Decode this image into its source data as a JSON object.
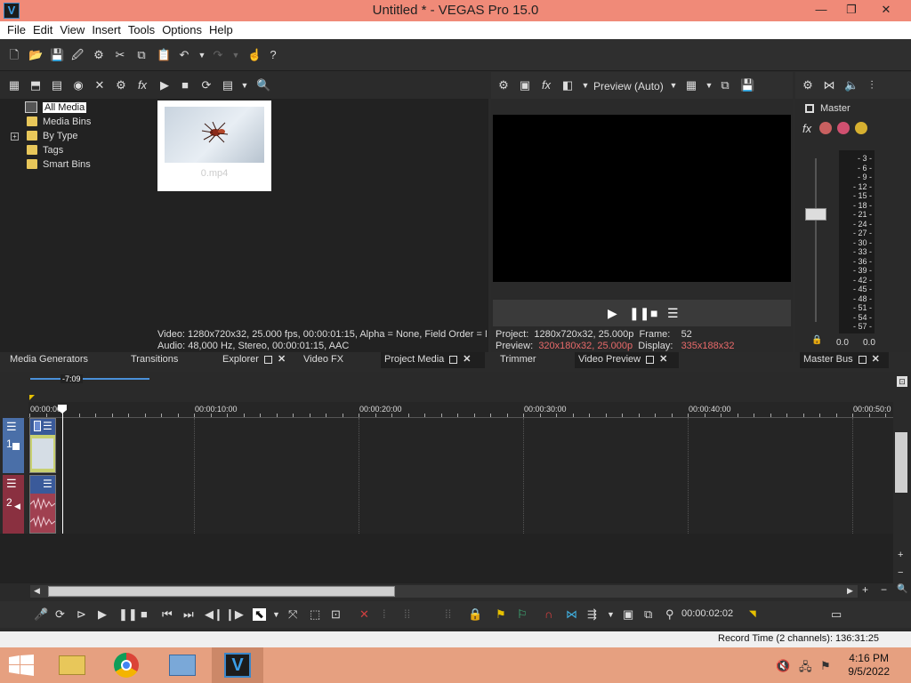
{
  "window": {
    "title": "Untitled * - VEGAS Pro 15.0",
    "logo_letter": "V",
    "min": "—",
    "max": "❐",
    "close": "✕"
  },
  "menu": [
    "File",
    "Edit",
    "View",
    "Insert",
    "Tools",
    "Options",
    "Help"
  ],
  "media_tree": [
    {
      "label": "All Media",
      "selected": true
    },
    {
      "label": "Media Bins"
    },
    {
      "label": "By Type",
      "expandable": true
    },
    {
      "label": "Tags"
    },
    {
      "label": "Smart Bins"
    }
  ],
  "media_file": {
    "name": "0.mp4"
  },
  "media_info": {
    "video": "Video: 1280x720x32, 25.000 fps, 00:00:01:15, Alpha = None, Field Order = None",
    "audio": "Audio: 48,000 Hz, Stereo, 00:00:01:15, AAC"
  },
  "left_tabs": [
    {
      "label": "Media Generators"
    },
    {
      "label": "Transitions"
    },
    {
      "label": "Explorer"
    },
    {
      "label": "Video FX"
    },
    {
      "label": "Project Media",
      "active": true
    }
  ],
  "preview": {
    "mode": "Preview (Auto)",
    "project_label": "Project:",
    "project_value": "1280x720x32, 25.000p",
    "frame_label": "Frame:",
    "frame_value": "52",
    "preview_label": "Preview:",
    "preview_value": "320x180x32, 25.000p",
    "display_label": "Display:",
    "display_value": "335x188x32"
  },
  "preview_tabs": [
    {
      "label": "Trimmer"
    },
    {
      "label": "Video Preview",
      "active": true
    }
  ],
  "master": {
    "label": "Master",
    "tab": "Master Bus",
    "meter_ticks": [
      "3",
      "6",
      "9",
      "12",
      "15",
      "18",
      "21",
      "24",
      "27",
      "30",
      "33",
      "36",
      "39",
      "42",
      "45",
      "48",
      "51",
      "54",
      "57"
    ],
    "left_value": "0.0",
    "right_value": "0.0"
  },
  "timeline": {
    "loop_label": "-7:09",
    "ruler_labels": [
      "00:00:00",
      "00:00:10:00",
      "00:00:20:00",
      "00:00:30:00",
      "00:00:40:00",
      "00:00:50:0"
    ],
    "track1_number": "1",
    "track2_number": "2",
    "time_readout": "00:00:02:02"
  },
  "status": {
    "record_time": "Record Time (2 channels): 136:31:25"
  },
  "taskbar": {
    "time": "4:16 PM",
    "date": "9/5/2022"
  },
  "colors": {
    "title_bar": "#f08a78",
    "taskbar": "#e6a080",
    "track_video": "#4a6fa8",
    "track_audio": "#8a3040",
    "highlight_value": "#e86a6a"
  }
}
